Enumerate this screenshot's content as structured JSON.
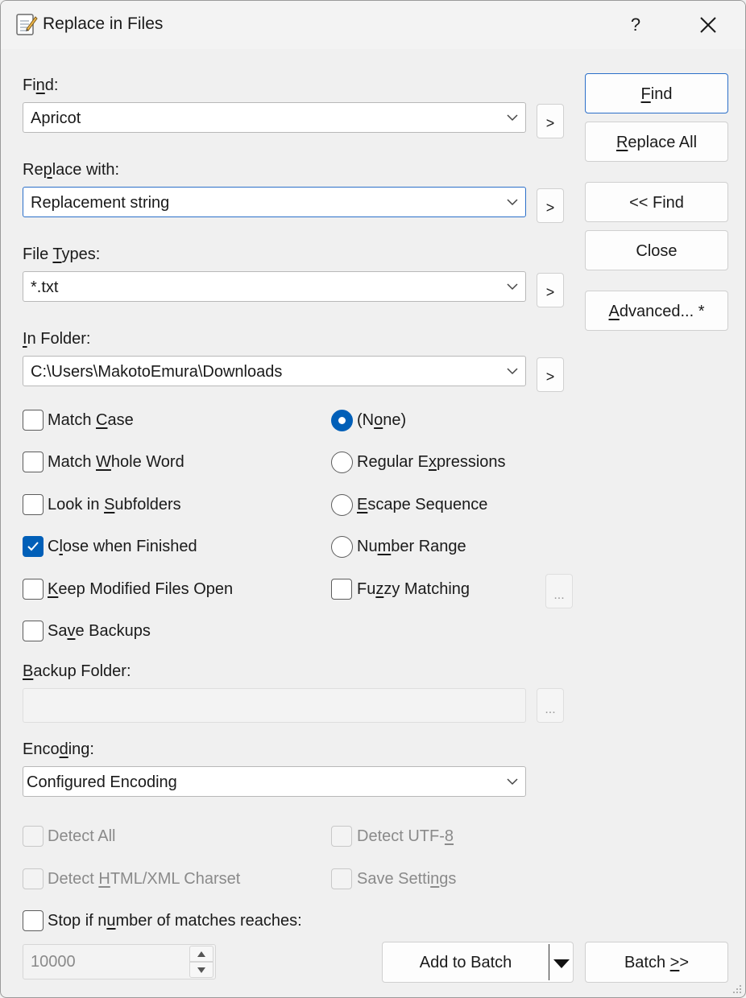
{
  "window": {
    "title": "Replace in Files",
    "help": "?"
  },
  "fields": {
    "find": {
      "label_pre": "Fi",
      "label_key": "n",
      "label_post": "d:",
      "value": "Apricot"
    },
    "replace": {
      "label_pre": "Re",
      "label_key": "p",
      "label_post": "lace with:",
      "value": "Replacement string"
    },
    "filetypes": {
      "label_pre": "File ",
      "label_key": "T",
      "label_post": "ypes:",
      "value": "*.txt"
    },
    "folder": {
      "label_pre": "",
      "label_key": "I",
      "label_post": "n Folder:",
      "value": "C:\\Users\\MakotoEmura\\Downloads"
    },
    "arrow": ">"
  },
  "buttons": {
    "find": {
      "pre": "",
      "key": "F",
      "post": "ind"
    },
    "replace_all": {
      "pre": "",
      "key": "R",
      "post": "eplace All"
    },
    "collapse": "<< Find",
    "close": "Close",
    "advanced": {
      "pre": "",
      "key": "A",
      "post": "dvanced... *"
    },
    "add_to_batch": "Add to Batch",
    "batch": {
      "pre": "Batch ",
      "key": ">",
      "post": ">"
    }
  },
  "options": {
    "match_case": {
      "pre": "Match ",
      "key": "C",
      "post": "ase",
      "checked": false
    },
    "whole_word": {
      "pre": "Match ",
      "key": "W",
      "post": "hole Word",
      "checked": false
    },
    "subfolders": {
      "pre": "Look in ",
      "key": "S",
      "post": "ubfolders",
      "checked": false
    },
    "close_finished": {
      "pre": "C",
      "key": "l",
      "post": "ose when Finished",
      "checked": true
    },
    "keep_open": {
      "pre": "",
      "key": "K",
      "post": "eep Modified Files Open",
      "checked": false
    },
    "save_backups": {
      "pre": "Sa",
      "key": "v",
      "post": "e Backups",
      "checked": false
    },
    "fuzzy": {
      "pre": "Fu",
      "key": "z",
      "post": "zy Matching",
      "checked": false
    }
  },
  "modes": {
    "none": {
      "pre": "(N",
      "key": "o",
      "post": "ne)",
      "selected": true
    },
    "regex": {
      "pre": "Regular E",
      "key": "x",
      "post": "pressions",
      "selected": false
    },
    "escape": {
      "pre": "",
      "key": "E",
      "post": "scape Sequence",
      "selected": false
    },
    "range": {
      "pre": "Nu",
      "key": "m",
      "post": "ber Range",
      "selected": false
    }
  },
  "backup": {
    "label_pre": "",
    "label_key": "B",
    "label_post": "ackup Folder:",
    "value": ""
  },
  "ellipsis": "...",
  "encoding": {
    "label_pre": "Enco",
    "label_key": "d",
    "label_post": "ing:",
    "value": "Configured Encoding"
  },
  "detect": {
    "all": {
      "pre": "Detect All",
      "key": "",
      "post": ""
    },
    "utf8": {
      "pre": "Detect UTF-",
      "key": "8",
      "post": ""
    },
    "html": {
      "pre": "Detect ",
      "key": "H",
      "post": "TML/XML Charset"
    },
    "save_settings": {
      "pre": "Save Setti",
      "key": "n",
      "post": "gs"
    }
  },
  "limit": {
    "pre": "Stop if n",
    "key": "u",
    "post": "mber of matches reaches:",
    "value": "10000",
    "checked": false
  },
  "colors": {
    "accent": "#005fb8",
    "focus_border": "#2b6fc9",
    "background": "#f0f0f0"
  }
}
